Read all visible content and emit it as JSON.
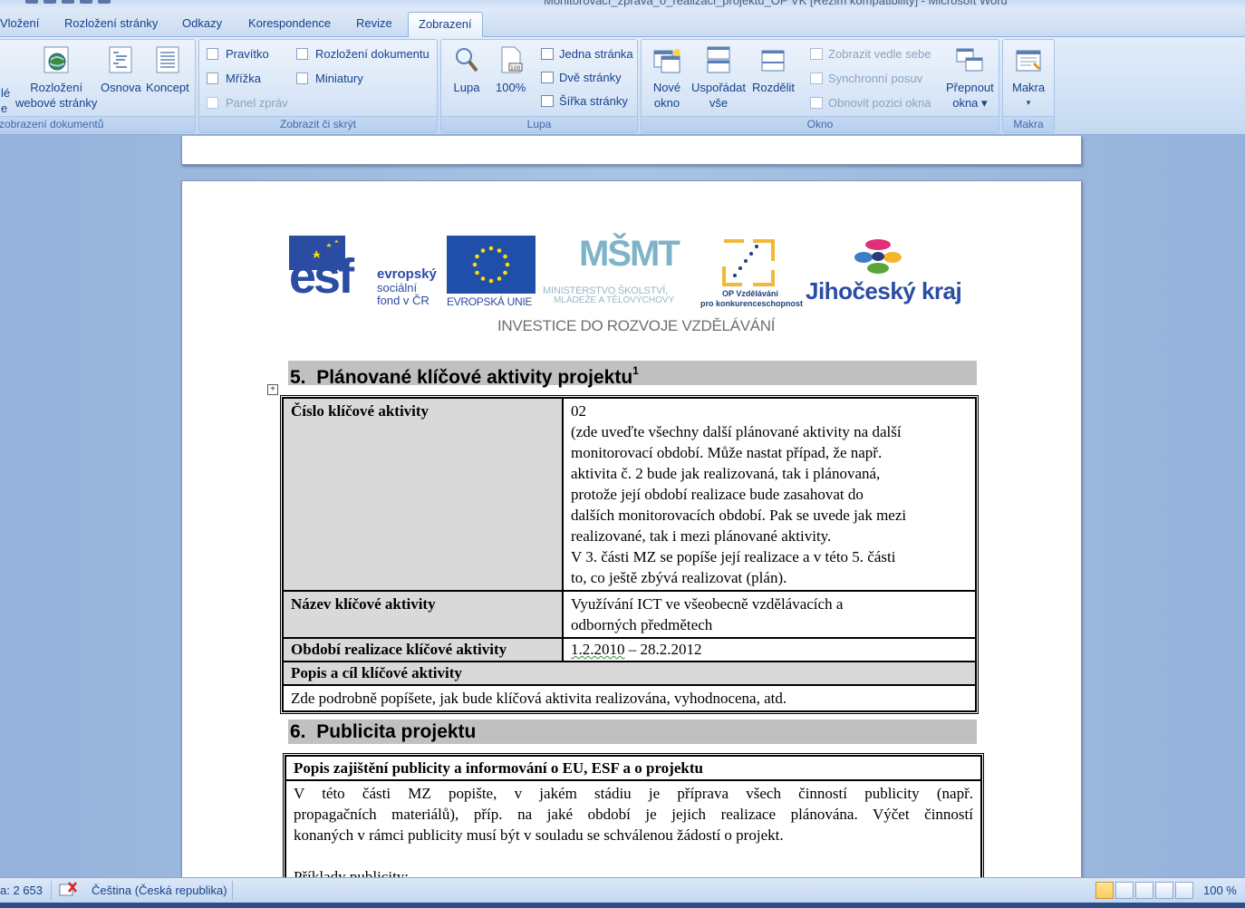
{
  "window": {
    "title": "Monitorovací_zprava_o_realizaci_projektu_OP VK [Režim kompatibility] - Microsoft Word"
  },
  "tabs": [
    "Vložení",
    "Rozložení stránky",
    "Odkazy",
    "Korespondence",
    "Revize",
    "Zobrazení"
  ],
  "ribbon": {
    "group1": {
      "label": "zobrazení dokumentů",
      "cut_label_1": "lé",
      "cut_label_2": "e",
      "buttons": [
        {
          "line1": "Rozložení",
          "line2": "webové stránky"
        },
        {
          "line1": "Osnova",
          "line2": ""
        },
        {
          "line1": "Koncept",
          "line2": ""
        }
      ]
    },
    "group2": {
      "label": "Zobrazit či skrýt",
      "checkboxes": [
        {
          "label": "Pravítko",
          "enabled": true
        },
        {
          "label": "Mřížka",
          "enabled": true
        },
        {
          "label": "Panel zpráv",
          "enabled": false
        },
        {
          "label": "Rozložení dokumentu",
          "enabled": true
        },
        {
          "label": "Miniatury",
          "enabled": true
        }
      ]
    },
    "group3": {
      "label": "Lupa",
      "lupa": "Lupa",
      "pct": "100%",
      "small": [
        "Jedna stránka",
        "Dvě stránky",
        "Šířka stránky"
      ]
    },
    "group4": {
      "label": "Okno",
      "nove": {
        "line1": "Nové",
        "line2": "okno"
      },
      "usporadat": {
        "line1": "Uspořádat",
        "line2": "vše"
      },
      "rozdelit": "Rozdělit",
      "small": [
        "Zobrazit vedle sebe",
        "Synchronní posuv",
        "Obnovit pozici okna"
      ],
      "prepnout": {
        "line1": "Přepnout",
        "line2": "okna ▾"
      }
    },
    "group5": {
      "label": "Makra",
      "makra": "Makra",
      "arrow": "▾"
    }
  },
  "logos": {
    "esf_big": "esf",
    "esf_text": [
      "evropský",
      "sociální",
      "fond v ČR"
    ],
    "eu": "EVROPSKÁ UNIE",
    "msmt_mark": "MŠMT",
    "msmt_text": [
      "MINISTERSTVO ŠKOLSTVÍ,",
      "MLÁDEŽE A TĚLOVÝCHOVY"
    ],
    "op_text": [
      "OP Vzdělávání",
      "pro konkurenceschopnost"
    ],
    "kraj": "Jihočeský kraj",
    "investice": "INVESTICE DO ROZVOJE VZDĚLÁVÁNÍ"
  },
  "section5": {
    "number": "5.",
    "title": "Plánované klíčové aktivity projektu",
    "footnote": "1",
    "rows": {
      "cislo_label": "Číslo klíčové aktivity",
      "cislo_value": "02",
      "cislo_lines": [
        "(zde uveďte všechny další plánované aktivity na další",
        "monitorovací období. Může nastat případ, že např.",
        "aktivita č. 2 bude jak realizovaná, tak i plánovaná,",
        "protože její období realizace bude zasahovat do",
        "dalších monitorovacích období. Pak se uvede jak mezi",
        "realizované, tak i mezi plánované aktivity.",
        "V 3. části MZ se popíše její realizace a v této 5. části",
        "to, co ještě zbývá realizovat (plán)."
      ],
      "nazev_label": "Název klíčové aktivity",
      "nazev_lines": [
        "Využívání ICT ve všeobecně vzdělávacích a",
        "odborných předmětech"
      ],
      "obdobi_label": "Období realizace klíčové aktivity",
      "obdobi_start": "1.2.2010",
      "obdobi_rest": " – 28.2.2012",
      "popis_label": "Popis a cíl klíčové aktivity",
      "popis_value": "Zde podrobně popíšete, jak bude klíčová aktivita realizována, vyhodnocena, atd."
    }
  },
  "section6": {
    "number": "6.",
    "title": "Publicita projektu",
    "header": "Popis zajištění publicity  a informování  o EU, ESF a o projektu",
    "lines": [
      "V této části MZ popište, v jakém stádiu je příprava všech činností publicity (např.",
      "propagačních materiálů), příp. na jaké období je jejich realizace plánována. Výčet činností",
      "konaných v rámci publicity musí být v souladu se schválenou žádostí o projekt."
    ],
    "examples": "Příklady publicity:"
  },
  "status": {
    "words": "a: 2 653",
    "language": "Čeština (Česká republika)",
    "zoom": "100 %"
  }
}
